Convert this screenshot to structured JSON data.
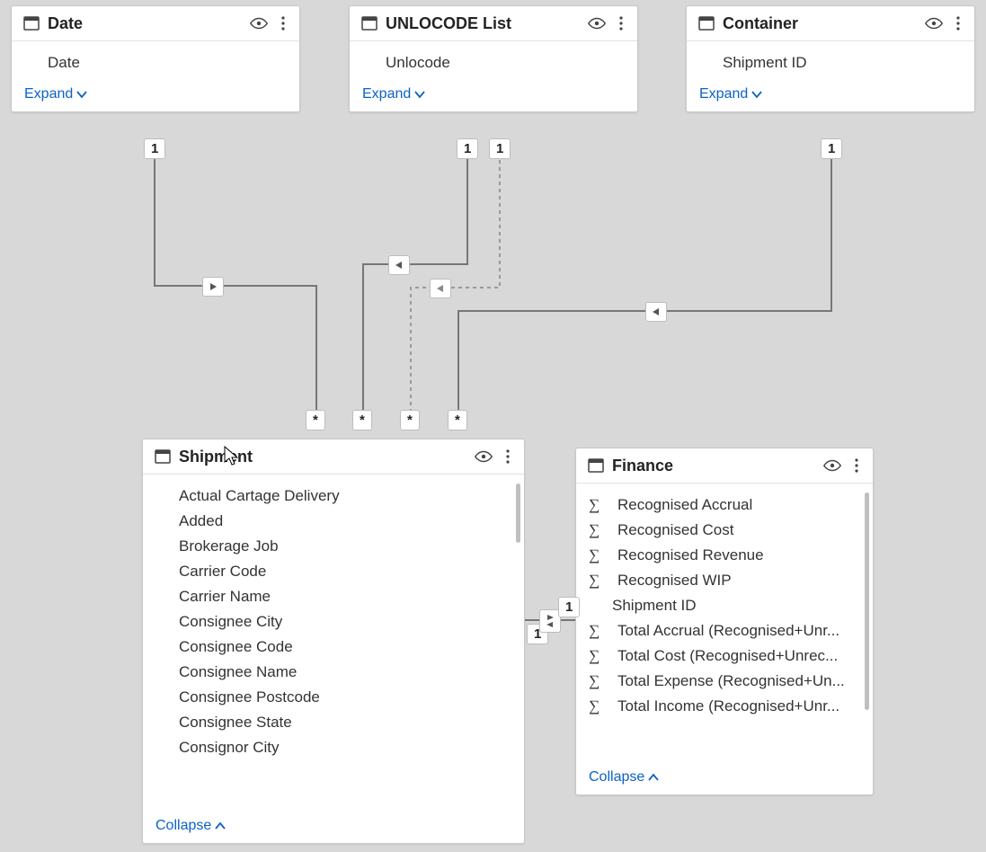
{
  "labels": {
    "expand": "Expand",
    "collapse": "Collapse"
  },
  "cardinality": {
    "one": "1",
    "many": "*"
  },
  "tables": {
    "date": {
      "title": "Date",
      "fields": [
        "Date"
      ]
    },
    "unlocode": {
      "title": "UNLOCODE List",
      "fields": [
        "Unlocode"
      ]
    },
    "container": {
      "title": "Container",
      "fields": [
        "Shipment ID"
      ]
    },
    "shipment": {
      "title": "Shipment",
      "fields": [
        "Actual Cartage Delivery",
        "Added",
        "Brokerage Job",
        "Carrier Code",
        "Carrier Name",
        "Consignee City",
        "Consignee Code",
        "Consignee Name",
        "Consignee Postcode",
        "Consignee State",
        "Consignor City"
      ]
    },
    "finance": {
      "title": "Finance",
      "fields": [
        {
          "measure": true,
          "label": "Recognised Accrual"
        },
        {
          "measure": true,
          "label": "Recognised Cost"
        },
        {
          "measure": true,
          "label": "Recognised Revenue"
        },
        {
          "measure": true,
          "label": "Recognised WIP"
        },
        {
          "measure": false,
          "label": "Shipment ID"
        },
        {
          "measure": true,
          "label": "Total Accrual (Recognised+Unr..."
        },
        {
          "measure": true,
          "label": "Total Cost (Recognised+Unrec..."
        },
        {
          "measure": true,
          "label": "Total Expense (Recognised+Un..."
        },
        {
          "measure": true,
          "label": "Total Income (Recognised+Unr..."
        }
      ]
    }
  },
  "relationships": [
    {
      "from": "date",
      "to": "shipment",
      "from_card": "1",
      "to_card": "*",
      "direction": "forward",
      "active": true
    },
    {
      "from": "unlocode",
      "to": "shipment",
      "from_card": "1",
      "to_card": "*",
      "direction": "backward",
      "active": true
    },
    {
      "from": "unlocode",
      "to": "shipment",
      "from_card": "1",
      "to_card": "*",
      "direction": "backward",
      "active": false
    },
    {
      "from": "container",
      "to": "shipment",
      "from_card": "1",
      "to_card": "*",
      "direction": "backward",
      "active": true
    },
    {
      "from": "shipment",
      "to": "finance",
      "from_card": "1",
      "to_card": "1",
      "direction": "both",
      "active": true
    }
  ]
}
